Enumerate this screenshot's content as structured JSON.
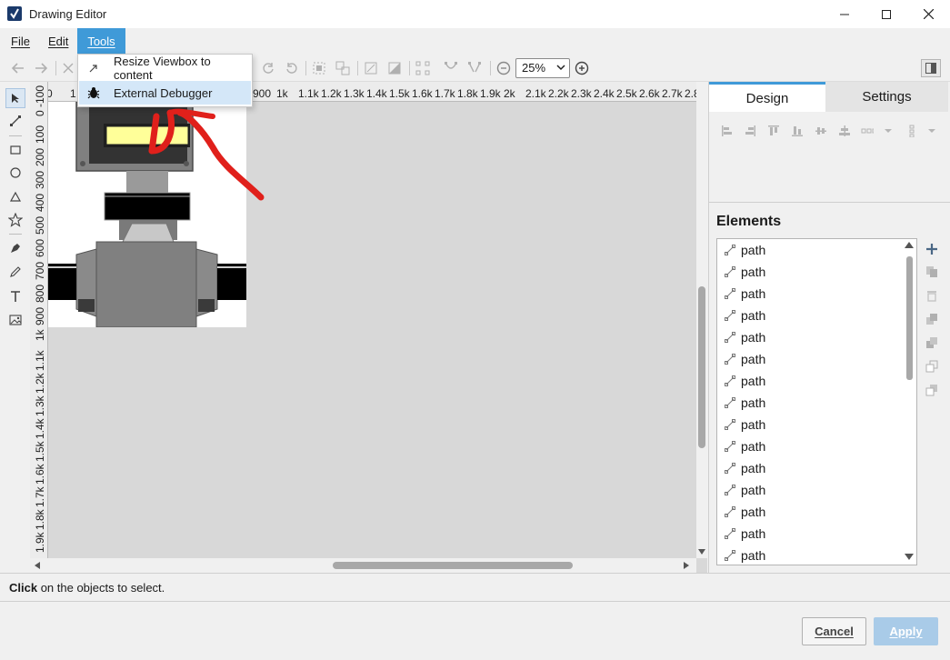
{
  "window": {
    "title": "Drawing Editor"
  },
  "menubar": {
    "items": [
      {
        "label": "File"
      },
      {
        "label": "Edit"
      },
      {
        "label": "Tools"
      }
    ]
  },
  "tools_menu": {
    "items": [
      {
        "label": "Resize Viewbox to content",
        "icon": "resize-viewbox-icon"
      },
      {
        "label": "External Debugger",
        "icon": "bug-icon"
      }
    ]
  },
  "toolbar": {
    "zoom_value": "25%"
  },
  "rulers": {
    "horizontal": [
      "0",
      "1",
      "900",
      "1k",
      "1.1k",
      "1.2k",
      "1.3k",
      "1.4k",
      "1.5k",
      "1.6k",
      "1.7k",
      "1.8k",
      "1.9k",
      "2k",
      "2.1k",
      "2.2k",
      "2.3k",
      "2.4k",
      "2.5k",
      "2.6k",
      "2.7k",
      "2.8"
    ],
    "vertical": [
      "0 -100",
      "100",
      "200",
      "300",
      "400",
      "500",
      "600",
      "700",
      "800",
      "900",
      "1k",
      "1.1k",
      "1.2k",
      "1.3k",
      "1.4k",
      "1.5k",
      "1.6k",
      "1.7k",
      "1.8k",
      "1.9k"
    ]
  },
  "right_panel": {
    "tabs": [
      {
        "label": "Design",
        "active": true
      },
      {
        "label": "Settings",
        "active": false
      }
    ],
    "elements_title": "Elements",
    "elements": [
      "path",
      "path",
      "path",
      "path",
      "path",
      "path",
      "path",
      "path",
      "path",
      "path",
      "path",
      "path",
      "path",
      "path",
      "path"
    ]
  },
  "status": {
    "bold": "Click",
    "rest": " on the objects to select."
  },
  "footer": {
    "cancel_label": "Cancel",
    "apply_label": "Apply"
  },
  "colors": {
    "accent": "#3f9ad8",
    "annotation_red": "#e0201b",
    "canvas_bg": "#d8d8d8"
  }
}
